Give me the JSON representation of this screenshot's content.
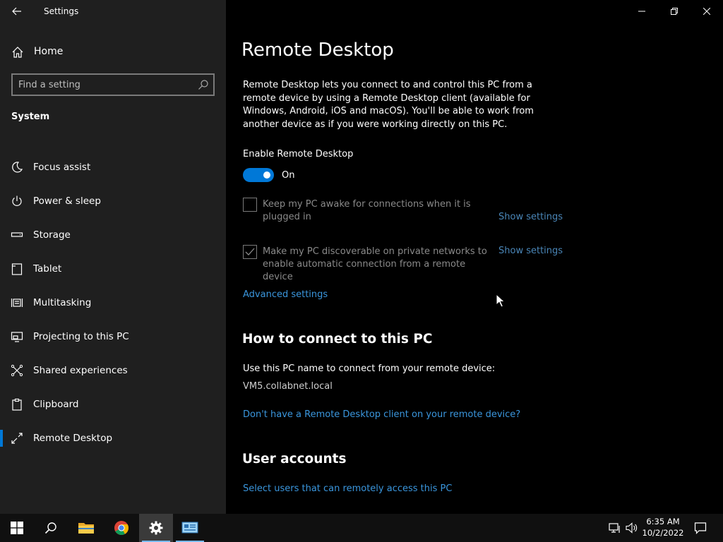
{
  "window": {
    "app_title": "Settings"
  },
  "sidebar": {
    "home_label": "Home",
    "search_placeholder": "Find a setting",
    "section": "System",
    "items": [
      {
        "label": "Focus assist",
        "icon": "moon-icon"
      },
      {
        "label": "Power & sleep",
        "icon": "power-icon"
      },
      {
        "label": "Storage",
        "icon": "storage-icon"
      },
      {
        "label": "Tablet",
        "icon": "tablet-icon"
      },
      {
        "label": "Multitasking",
        "icon": "multitasking-icon"
      },
      {
        "label": "Projecting to this PC",
        "icon": "projecting-icon"
      },
      {
        "label": "Shared experiences",
        "icon": "shared-experiences-icon"
      },
      {
        "label": "Clipboard",
        "icon": "clipboard-icon"
      },
      {
        "label": "Remote Desktop",
        "icon": "remote-desktop-icon",
        "active": true
      }
    ]
  },
  "main": {
    "title": "Remote Desktop",
    "description": "Remote Desktop lets you connect to and control this PC from a remote device by using a Remote Desktop client (available for Windows, Android, iOS and macOS). You'll be able to work from another device as if you were working directly on this PC.",
    "enable_label": "Enable Remote Desktop",
    "toggle_state": "On",
    "options": [
      {
        "label": "Keep my PC awake for connections when it is plugged in",
        "checked": false,
        "link": "Show settings"
      },
      {
        "label": "Make my PC discoverable on private networks to enable automatic connection from a remote device",
        "checked": true,
        "link": "Show settings"
      }
    ],
    "advanced_link": "Advanced settings",
    "connect_heading": "How to connect to this PC",
    "connect_text": "Use this PC name to connect from your remote device:",
    "pc_name": "VM5.collabnet.local",
    "client_link": "Don't have a Remote Desktop client on your remote device?",
    "accounts_heading": "User accounts",
    "accounts_link": "Select users that can remotely access this PC"
  },
  "taskbar": {
    "time": "6:35 AM",
    "date": "10/2/2022"
  },
  "colors": {
    "accent": "#0078d7",
    "link": "#3a96dd",
    "sidebar_bg": "#1f1f1f",
    "main_bg": "#000000",
    "taskbar_bg": "#101010"
  }
}
